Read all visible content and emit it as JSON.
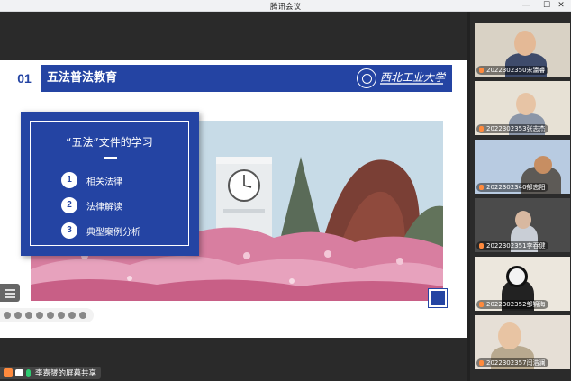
{
  "window": {
    "title": "腾讯会议",
    "controls": [
      "—",
      "☐",
      "✕"
    ]
  },
  "slide": {
    "number": "01",
    "title": "五法普法教育",
    "university_name": "西北工业大学",
    "panel": {
      "heading": "“五法”文件的学习",
      "items": [
        {
          "num": "1",
          "label": "相关法律"
        },
        {
          "num": "2",
          "label": "法律解读"
        },
        {
          "num": "3",
          "label": "典型案例分析"
        }
      ]
    }
  },
  "screen_share": {
    "owner_label": "李嘉赟的屏幕共享"
  },
  "participants": [
    {
      "name": "2022302350宋瀛睿"
    },
    {
      "name": "2022302353张志杰"
    },
    {
      "name": "2022302340郁志阳"
    },
    {
      "name": "2022302351李吞健"
    },
    {
      "name": "2022302352邹锦海"
    },
    {
      "name": "2022302357闫浩澜"
    }
  ],
  "colors": {
    "slide_blue": "#2444a3",
    "status_orange": "#ff8a3d",
    "mic_green": "#2ecc71"
  }
}
